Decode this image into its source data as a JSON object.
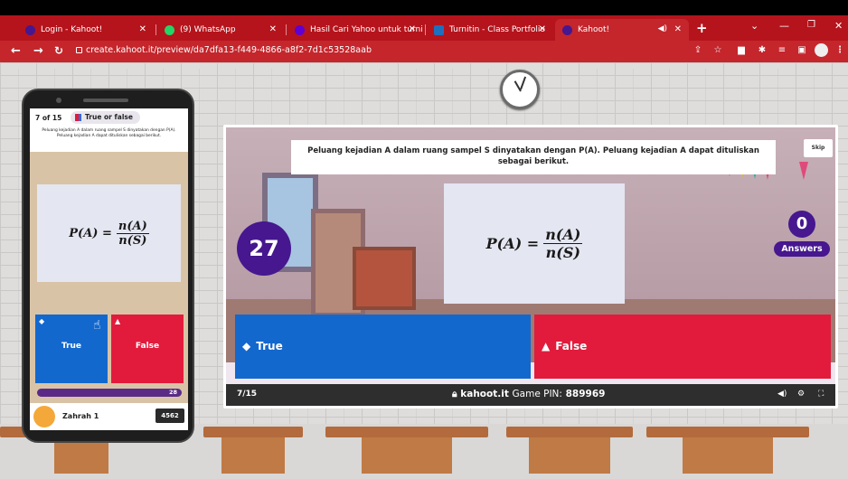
{
  "browser": {
    "tabs": [
      {
        "label": "Login - Kahoot!",
        "favicon_color": "#46178f"
      },
      {
        "label": "(9) WhatsApp",
        "favicon_color": "#25d366"
      },
      {
        "label": "Hasil Cari Yahoo untuk turnit",
        "favicon_color": "#6001d2"
      },
      {
        "label": "Turnitin - Class Portfolio",
        "favicon_color": "#1f6fbf"
      },
      {
        "label": "Kahoot!",
        "favicon_color": "#46178f"
      }
    ],
    "new_tab_label": "+",
    "url": "create.kahoot.it/preview/da7dfa13-f449-4866-a8f2-7d1c53528aab"
  },
  "phone": {
    "question_counter": "7 of 15",
    "question_type": "True or false",
    "question_text": "Peluang kejadian A dalam ruang sampel S dinyatakan dengan P(A). Peluang kejadian A dapat dituliskan sebagai berikut.",
    "formula": {
      "lhs": "P(A) =",
      "numerator": "n(A)",
      "denominator": "n(S)"
    },
    "answers": [
      {
        "label": "True",
        "symbol": "◆",
        "color": "#1368ce"
      },
      {
        "label": "False",
        "symbol": "▲",
        "color": "#e21b3c"
      }
    ],
    "progress_value": "28",
    "player_name": "Zahrah 1",
    "player_score": "4562"
  },
  "game": {
    "question_text": "Peluang kejadian A dalam ruang sampel S dinyatakan dengan P(A). Peluang kejadian A dapat dituliskan sebagai berikut.",
    "skip_label": "Skip",
    "timer": "27",
    "answers_count": "0",
    "answers_label": "Answers",
    "formula": {
      "lhs": "P(A) =",
      "numerator": "n(A)",
      "denominator": "n(S)"
    },
    "answers": [
      {
        "label": "True",
        "symbol": "◆",
        "color": "#1368ce"
      },
      {
        "label": "False",
        "symbol": "▲",
        "color": "#e21b3c"
      }
    ],
    "footer": {
      "question_progress": "7/15",
      "site": "kahoot.it",
      "pin_label": "Game PIN:",
      "pin": "889969"
    }
  },
  "colors": {
    "kahoot_purple": "#46178f",
    "chrome_red": "#c4262c"
  }
}
